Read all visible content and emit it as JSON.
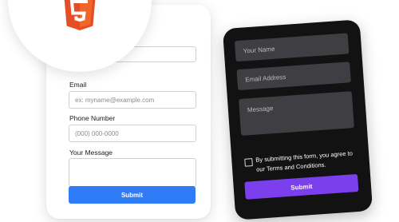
{
  "light_form": {
    "email_label": "Email",
    "email_placeholder": "ex: myname@example.com",
    "phone_label": "Phone Number",
    "phone_placeholder": "(000) 000-0000",
    "message_label": "Your Message",
    "submit_label": "Submit"
  },
  "dark_form": {
    "name_placeholder": "Your Name",
    "email_placeholder": "Email Address",
    "message_placeholder": "Message",
    "consent_text": "By submitting this form, you agree to our Terms and Conditions.",
    "submit_label": "Submit"
  },
  "logo": {
    "icon": "html5-icon",
    "color": "#e44d26"
  },
  "colors": {
    "light_submit": "#2f7cf6",
    "dark_submit": "#7b3fee",
    "dark_card": "#121212"
  }
}
